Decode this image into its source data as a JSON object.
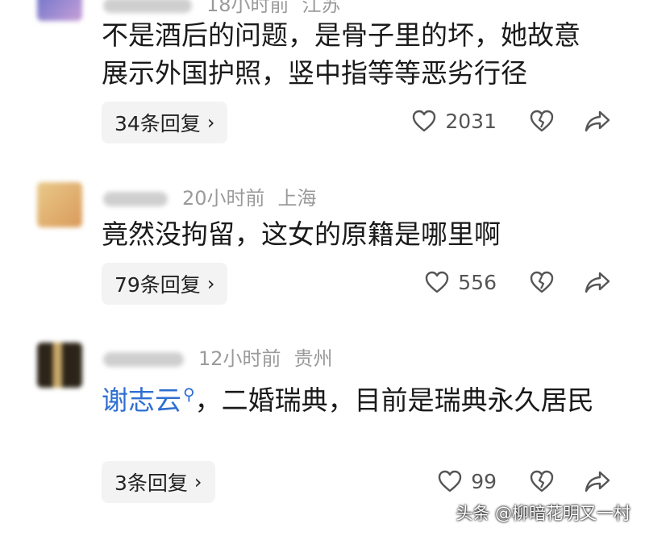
{
  "comments": [
    {
      "time": "18小时前",
      "location": "江苏",
      "text": "不是酒后的问题，是骨子里的坏，她故意展示外国护照，竖中指等等恶劣行径",
      "reply_label": "34条回复",
      "likes": "2031"
    },
    {
      "time": "20小时前",
      "location": "上海",
      "text": "竟然没拘留，这女的原籍是哪里啊",
      "reply_label": "79条回复",
      "likes": "556"
    },
    {
      "time": "12小时前",
      "location": "贵州",
      "mention": "谢志云",
      "text": "，二婚瑞典，目前是瑞典永久居民",
      "reply_label": "3条回复",
      "likes": "99"
    }
  ],
  "watermark": "头条 @柳暗花明又一村",
  "icons": {
    "like": "heart-outline-icon",
    "dislike": "broken-heart-icon",
    "share": "share-arrow-icon",
    "chevron": "chevron-right-icon",
    "search": "search-icon"
  }
}
